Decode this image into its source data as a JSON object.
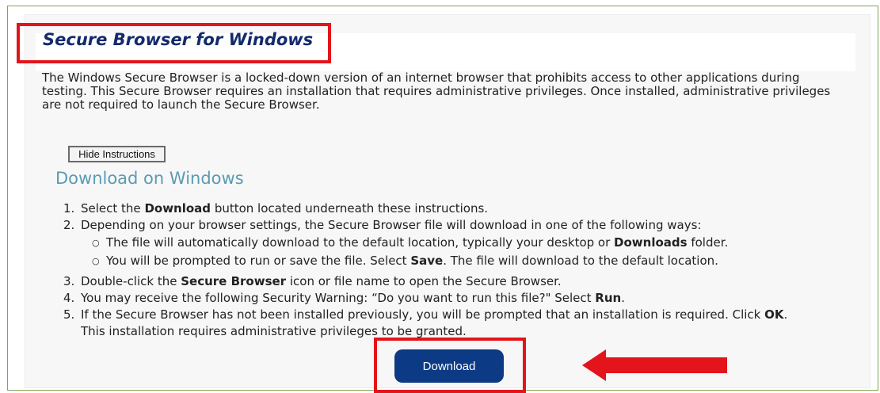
{
  "header": {
    "title": "Secure Browser for Windows"
  },
  "description": "The Windows Secure Browser is a locked-down version of an internet browser that prohibits access to other applications during testing. This Secure Browser requires an installation that requires administrative privileges. Once installed, administrative privileges are not required to launch the Secure Browser.",
  "hide_button": {
    "label": "Hide Instructions"
  },
  "section": {
    "heading": "Download on Windows"
  },
  "steps": [
    {
      "num": "1.",
      "pre": "Select the ",
      "bold": "Download",
      "post": " button located underneath these instructions."
    },
    {
      "num": "2.",
      "text": "Depending on your browser settings, the Secure Browser file will download in one of the following ways:",
      "subitems": [
        {
          "pre": "The file will automatically download to the default location, typically your desktop or ",
          "bold": "Downloads",
          "post": " folder."
        },
        {
          "pre": "You will be prompted to run or save the file. Select ",
          "bold": "Save",
          "post": ". The file will download to the default location."
        }
      ]
    },
    {
      "num": "3.",
      "pre": "Double-click the ",
      "bold": "Secure Browser",
      "post": " icon or file name to open the Secure Browser."
    },
    {
      "num": "4.",
      "pre": "You may receive the following Security Warning: “Do you want to run this file?\" Select ",
      "bold": "Run",
      "post": "."
    },
    {
      "num": "5.",
      "pre": "If the Secure Browser has not been installed previously, you will be prompted that an installation is required. Click ",
      "bold": "OK",
      "post": ". This installation requires administrative privileges to be granted."
    }
  ],
  "download_button": {
    "label": "Download"
  },
  "colors": {
    "title": "#132a6c",
    "heading": "#5a9bb3",
    "button": "#0c3a84",
    "annotation": "#e3141b",
    "frame": "#7fa557"
  },
  "annotations": {
    "arrow_icon": "left-arrow-icon"
  }
}
